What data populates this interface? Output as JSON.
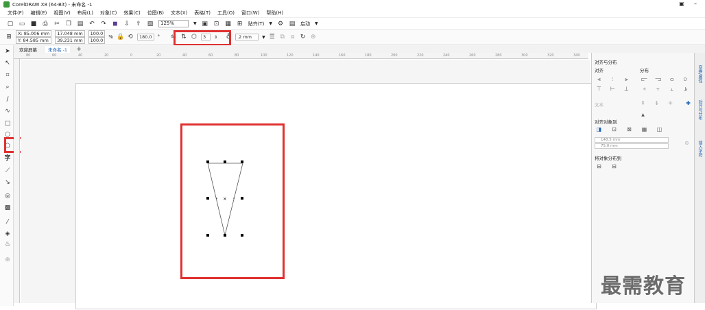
{
  "window": {
    "title": "CorelDRAW X8 (64-Bit) - 未命名 -1"
  },
  "menu": [
    "文件(F)",
    "编辑(E)",
    "视图(V)",
    "布局(L)",
    "对象(C)",
    "效果(C)",
    "位图(B)",
    "文本(X)",
    "表格(T)",
    "工具(O)",
    "窗口(W)",
    "帮助(H)"
  ],
  "toolbar": {
    "zoom": "125%",
    "snap_label": "贴齐(T)",
    "launch_label": "启动"
  },
  "propbar": {
    "x": "X: 85.006 mm",
    "y": "Y: 84.585 mm",
    "w": "17.048 mm",
    "h": "39.231 mm",
    "scale_w": "100.0",
    "scale_h": "100.0",
    "pct": "%",
    "rotation": "180.0",
    "rotation_unit": "°",
    "sides": "3",
    "outline_width": ".2 mm"
  },
  "tabs": {
    "welcome": "欢迎屏幕",
    "doc": "未命名 -1"
  },
  "ruler_ticks": [
    "80",
    "60",
    "40",
    "20",
    "0",
    "20",
    "40",
    "60",
    "80",
    "100",
    "120",
    "140",
    "160",
    "180",
    "200",
    "220",
    "240",
    "260",
    "280",
    "300",
    "320",
    "340"
  ],
  "panel": {
    "title": "对齐与分布",
    "align_label": "对齐",
    "distribute_label": "分布",
    "text_label": "文本",
    "align_to_label": "对齐对象到",
    "x_field": "148.5 mm",
    "y_field": "75.0 mm",
    "distribute_to_label": "将对象分布到"
  },
  "side_tabs": [
    "变换/属性",
    "对齐与分布",
    "插入字符"
  ],
  "watermark": "最需教育",
  "colors": {
    "highlight": "#e03030",
    "accent": "#1a5fb4"
  }
}
